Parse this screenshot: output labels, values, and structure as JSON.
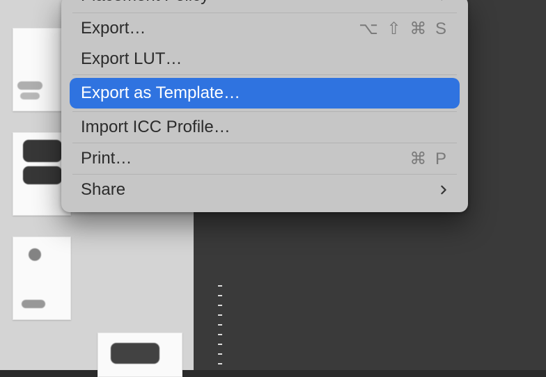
{
  "menu": {
    "items": {
      "placement_policy": {
        "label": "Placement Policy",
        "has_submenu": true
      },
      "export": {
        "label": "Export…",
        "shortcut": "⌥ ⇧ ⌘ S"
      },
      "export_lut": {
        "label": "Export LUT…"
      },
      "export_template": {
        "label": "Export as Template…",
        "highlighted": true
      },
      "import_icc": {
        "label": "Import ICC Profile…"
      },
      "print": {
        "label": "Print…",
        "shortcut": "⌘ P"
      },
      "share": {
        "label": "Share",
        "has_submenu": true
      }
    }
  }
}
